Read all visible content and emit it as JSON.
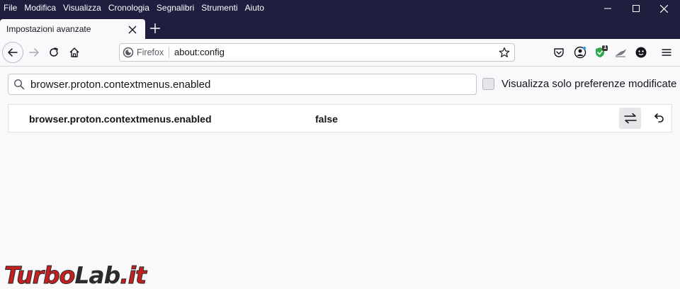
{
  "menubar": {
    "items": [
      "File",
      "Modifica",
      "Visualizza",
      "Cronologia",
      "Segnalibri",
      "Strumenti",
      "Aiuto"
    ]
  },
  "tab": {
    "title": "Impostazioni avanzate"
  },
  "urlbar": {
    "identity_label": "Firefox",
    "url": "about:config"
  },
  "toolbar": {
    "extension_badge": "1"
  },
  "search": {
    "value": "browser.proton.contextmenus.enabled"
  },
  "filter": {
    "label": "Visualizza solo preferenze modificate",
    "checked": false
  },
  "preference": {
    "name": "browser.proton.contextmenus.enabled",
    "value": "false"
  },
  "watermark": {
    "part1": "Turbo",
    "part2": "Lab",
    "part3": ".it"
  },
  "colors": {
    "titlebar": "#1f1e3f",
    "content": "#f9f9fb",
    "watermark_red": "#c51f1f"
  }
}
